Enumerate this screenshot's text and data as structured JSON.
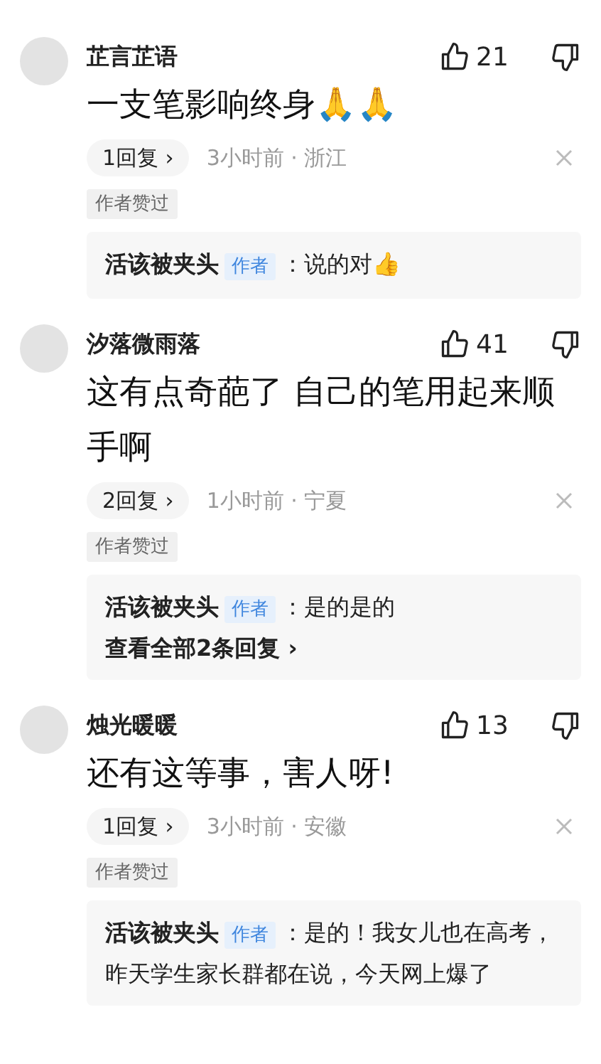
{
  "comments": [
    {
      "author": "芷言芷语",
      "likes": "21",
      "text": "一支笔影响终身🙏🙏",
      "replies_button": "1回复 ›",
      "meta": "3小时前 · 浙江",
      "author_liked": "作者赞过",
      "reply": {
        "author": "活该被夹头",
        "badge": "作者",
        "text": "：说的对👍"
      }
    },
    {
      "author": "汐落微雨落",
      "likes": "41",
      "text": "这有点奇葩了 自己的笔用起来顺手啊",
      "replies_button": "2回复 ›",
      "meta": "1小时前 · 宁夏",
      "author_liked": "作者赞过",
      "reply": {
        "author": "活该被夹头",
        "badge": "作者",
        "text": "：是的是的"
      },
      "view_all": "查看全部2条回复 ›"
    },
    {
      "author": "烛光暖暖",
      "likes": "13",
      "text": "还有这等事，害人呀!",
      "replies_button": "1回复 ›",
      "meta": "3小时前 · 安徽",
      "author_liked": "作者赞过",
      "reply": {
        "author": "活该被夹头",
        "badge": "作者",
        "text": "：是的！我女儿也在高考，昨天学生家长群都在说，今天网上爆了"
      }
    }
  ]
}
